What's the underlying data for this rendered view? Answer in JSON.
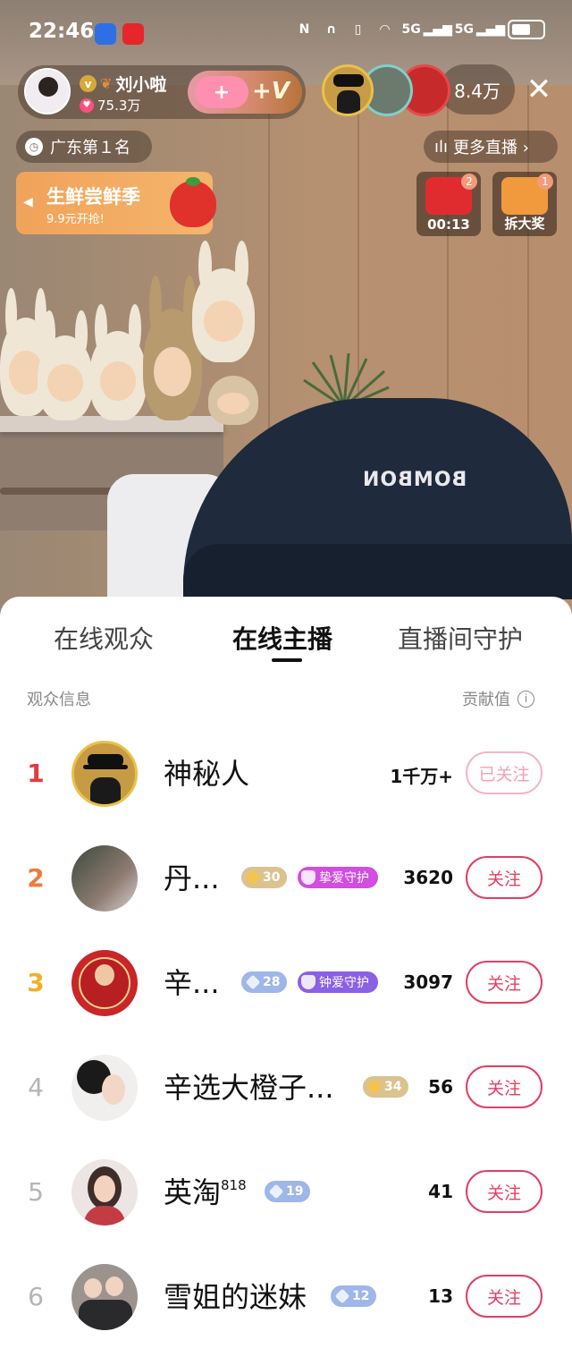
{
  "status_bar": {
    "time": "22:46",
    "net1": "5G",
    "net2": "5G"
  },
  "host": {
    "name": "刘小啦",
    "fans": "75.3万",
    "verified_icon": "v-badge",
    "follow_plus": "+",
    "follow_v": "+V"
  },
  "viewers": {
    "count": "8.4万"
  },
  "rank_badge": {
    "text": "广东第１名"
  },
  "more_live": {
    "text": "更多直播 ›"
  },
  "promo": {
    "title": "生鲜尝鲜季",
    "subtitle": "9.9元开抢!"
  },
  "gifts": [
    {
      "badge": "2",
      "label": "00:13"
    },
    {
      "badge": "1",
      "label": "拆大奖"
    }
  ],
  "video": {
    "cap_logo": "BOMBON"
  },
  "sheet": {
    "tabs": [
      "在线观众",
      "在线主播",
      "直播间守护"
    ],
    "active_tab": 1,
    "col_left": "观众信息",
    "col_right": "贡献值"
  },
  "audience": [
    {
      "rank": "1",
      "name": "神秘人",
      "level": null,
      "guard": null,
      "score": "1千万+",
      "follow": "已关注",
      "followed": true
    },
    {
      "rank": "2",
      "name": "丹...",
      "level": "30",
      "level_color": "gold",
      "guard": "挚爱守护",
      "guard_color": "pink",
      "score": "3620",
      "follow": "关注",
      "followed": false
    },
    {
      "rank": "3",
      "name": "辛...",
      "level": "28",
      "level_color": "blue",
      "guard": "钟爱守护",
      "guard_color": "purple",
      "score": "3097",
      "follow": "关注",
      "followed": false
    },
    {
      "rank": "4",
      "name": "辛选大橙子...",
      "level": "34",
      "level_color": "gold",
      "guard": null,
      "score": "56",
      "follow": "关注",
      "followed": false
    },
    {
      "rank": "5",
      "name": "英淘",
      "name_sup": "818",
      "level": "19",
      "level_color": "blue",
      "guard": null,
      "score": "41",
      "follow": "关注",
      "followed": false
    },
    {
      "rank": "6",
      "name": "雪姐的迷妹",
      "level": "12",
      "level_color": "blue",
      "guard": null,
      "score": "13",
      "follow": "关注",
      "followed": false
    }
  ],
  "colors": {
    "accent": "#e23e63",
    "rank1": "#e33b3b",
    "rank2": "#ed7b3e",
    "rank3": "#f0b128"
  }
}
